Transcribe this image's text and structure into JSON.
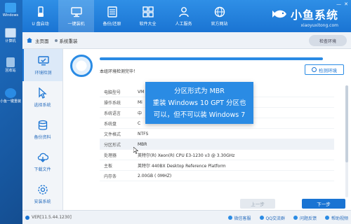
{
  "desktop": {
    "icons": [
      {
        "label": "Windows"
      },
      {
        "label": "计算机"
      },
      {
        "label": "回收站"
      },
      {
        "label": "小鱼一键重装"
      }
    ]
  },
  "nav": {
    "items": [
      {
        "label": "U 盘启动",
        "icon": "usb-icon"
      },
      {
        "label": "一键装机",
        "icon": "monitor-icon",
        "active": true
      },
      {
        "label": "备份/还原",
        "icon": "backup-icon"
      },
      {
        "label": "软件大全",
        "icon": "grid-icon"
      },
      {
        "label": "人工服务",
        "icon": "person-icon"
      },
      {
        "label": "官方网站",
        "icon": "globe-icon"
      }
    ]
  },
  "brand": {
    "name": "小鱼系统",
    "url": "xiaoyuxitong.com"
  },
  "crumbs": {
    "home": "主页面",
    "current": "系统重装"
  },
  "header_btn": "检查环境",
  "sidebar": {
    "items": [
      {
        "label": "环境检测",
        "icon": "monitor-check-icon",
        "active": true
      },
      {
        "label": "选择系统",
        "icon": "cursor-icon"
      },
      {
        "label": "备份资料",
        "icon": "database-icon"
      },
      {
        "label": "下载文件",
        "icon": "download-icon"
      },
      {
        "label": "安装系统",
        "icon": "settings-icon"
      }
    ]
  },
  "scan": {
    "status": "本组环境检测完毕！",
    "progress": 1.0,
    "button": "检测环境"
  },
  "info": {
    "rows": [
      {
        "key": "电脑型号",
        "value": "VM"
      },
      {
        "key": "操作系统",
        "value": "Mi"
      },
      {
        "key": "系统语言",
        "value": "中"
      },
      {
        "key": "系统盘",
        "value": "C"
      },
      {
        "key": "文件格式",
        "value": "NTFS"
      },
      {
        "key": "分区形式",
        "value": "MBR",
        "highlight": true
      },
      {
        "key": "处理器",
        "value": "英特尔(R) Xeon(R) CPU E3-1230 v3 @ 3.30GHz"
      },
      {
        "key": "主板",
        "value": "英特尔 440BX Desktop Reference Platform"
      },
      {
        "key": "内存条",
        "value": "2.00GB ( 0MHZ)"
      }
    ]
  },
  "buttons": {
    "prev": "上一步",
    "next": "下一步"
  },
  "status": {
    "version": "VER[11.5.44.1230]",
    "links": [
      {
        "label": "微信客服",
        "icon": "wechat-icon"
      },
      {
        "label": "QQ交流群",
        "icon": "qq-icon"
      },
      {
        "label": "问题反馈",
        "icon": "feedback-icon"
      },
      {
        "label": "帮助视频",
        "icon": "video-icon"
      }
    ]
  },
  "callout": {
    "line1": "分区形式为 MBR",
    "line2": "重装 Windows 10 GPT 分区也",
    "line3": "可以，但不可以装 Windows 7"
  },
  "colors": {
    "accent": "#1a74d3",
    "callout": "#2a8be4"
  }
}
